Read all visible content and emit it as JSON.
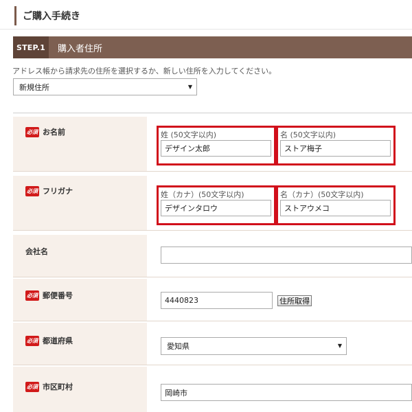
{
  "header": {
    "title": "ご購入手続き"
  },
  "step": {
    "badge": "STEP.1",
    "title": "購入者住所"
  },
  "instruction": "アドレス帳から請求先の住所を選択するか、新しい住所を入力してください。",
  "address_select": {
    "value": "新規住所"
  },
  "required_badge": "必須",
  "form": {
    "name": {
      "label": "お名前",
      "last": {
        "caption": "姓 (50文字以内)",
        "value": "デザイン太郎"
      },
      "first": {
        "caption": "名 (50文字以内)",
        "value": "ストア梅子"
      }
    },
    "furigana": {
      "label": "フリガナ",
      "last": {
        "caption": "姓（カナ）(50文字以内)",
        "value": "デザインタロウ"
      },
      "first": {
        "caption": "名（カナ）(50文字以内)",
        "value": "ストアウメコ"
      }
    },
    "company": {
      "label": "会社名",
      "value": ""
    },
    "postal": {
      "label": "郵便番号",
      "value": "4440823",
      "button": "住所取得"
    },
    "prefecture": {
      "label": "都道府県",
      "value": "愛知県"
    },
    "city": {
      "label": "市区町村",
      "value": "岡崎市"
    }
  },
  "colors": {
    "accent": "#7d5f51",
    "required": "#d11a1a",
    "highlight": "#d10f1b",
    "label_bg": "#f7f0ea"
  }
}
